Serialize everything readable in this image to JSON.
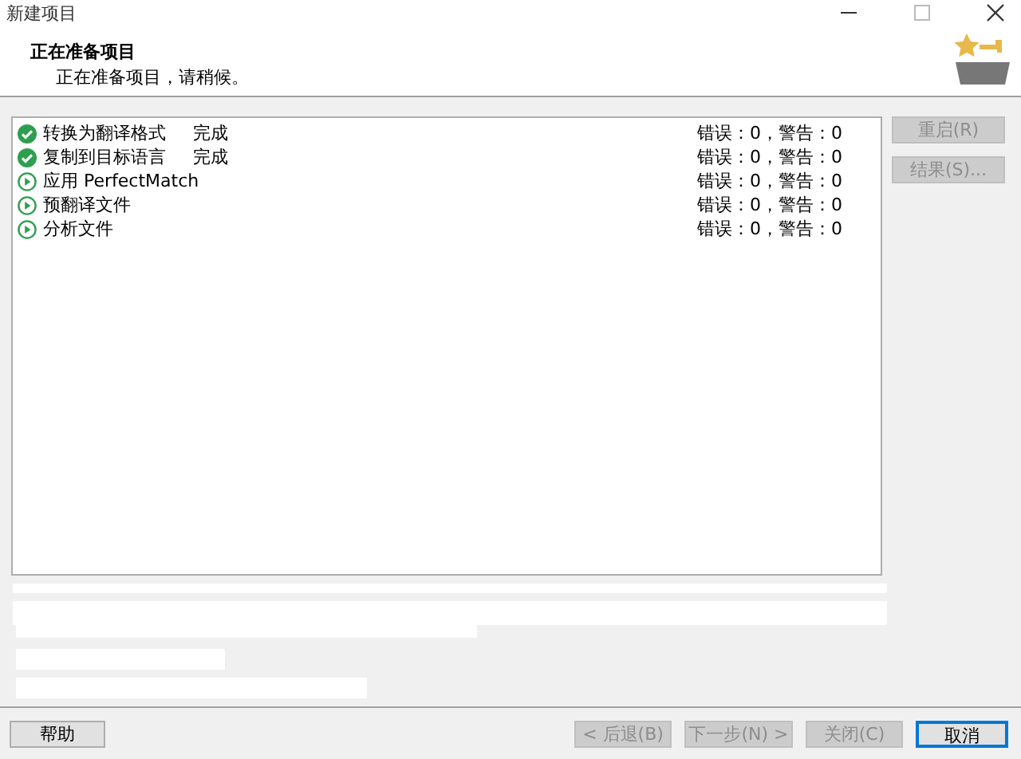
{
  "window": {
    "title": "新建项目"
  },
  "header": {
    "title": "正在准备项目",
    "subtitle": "正在准备项目，请稍候。"
  },
  "tasks": [
    {
      "kind": "done",
      "name": "转换为翻译格式",
      "status": "完成",
      "result": "错误：0，警告：0"
    },
    {
      "kind": "done",
      "name": "复制到目标语言",
      "status": "完成",
      "result": "错误：0，警告：0"
    },
    {
      "kind": "pending",
      "name": "应用 PerfectMatch",
      "result": "错误：0，警告：0"
    },
    {
      "kind": "pending",
      "name": "预翻译文件",
      "result": "错误：0，警告：0"
    },
    {
      "kind": "pending",
      "name": "分析文件",
      "result": "错误：0，警告：0"
    }
  ],
  "side_buttons": [
    {
      "label": "重启(R)",
      "disabled": true
    },
    {
      "label": "结果(S)...",
      "disabled": true
    }
  ],
  "footer": {
    "help": "帮助",
    "buttons": [
      {
        "label": "< 后退(B)",
        "disabled": true
      },
      {
        "label": "下一步(N) >",
        "disabled": true
      },
      {
        "label": "关闭(C)",
        "disabled": true
      },
      {
        "label": "取消",
        "disabled": false
      }
    ]
  }
}
